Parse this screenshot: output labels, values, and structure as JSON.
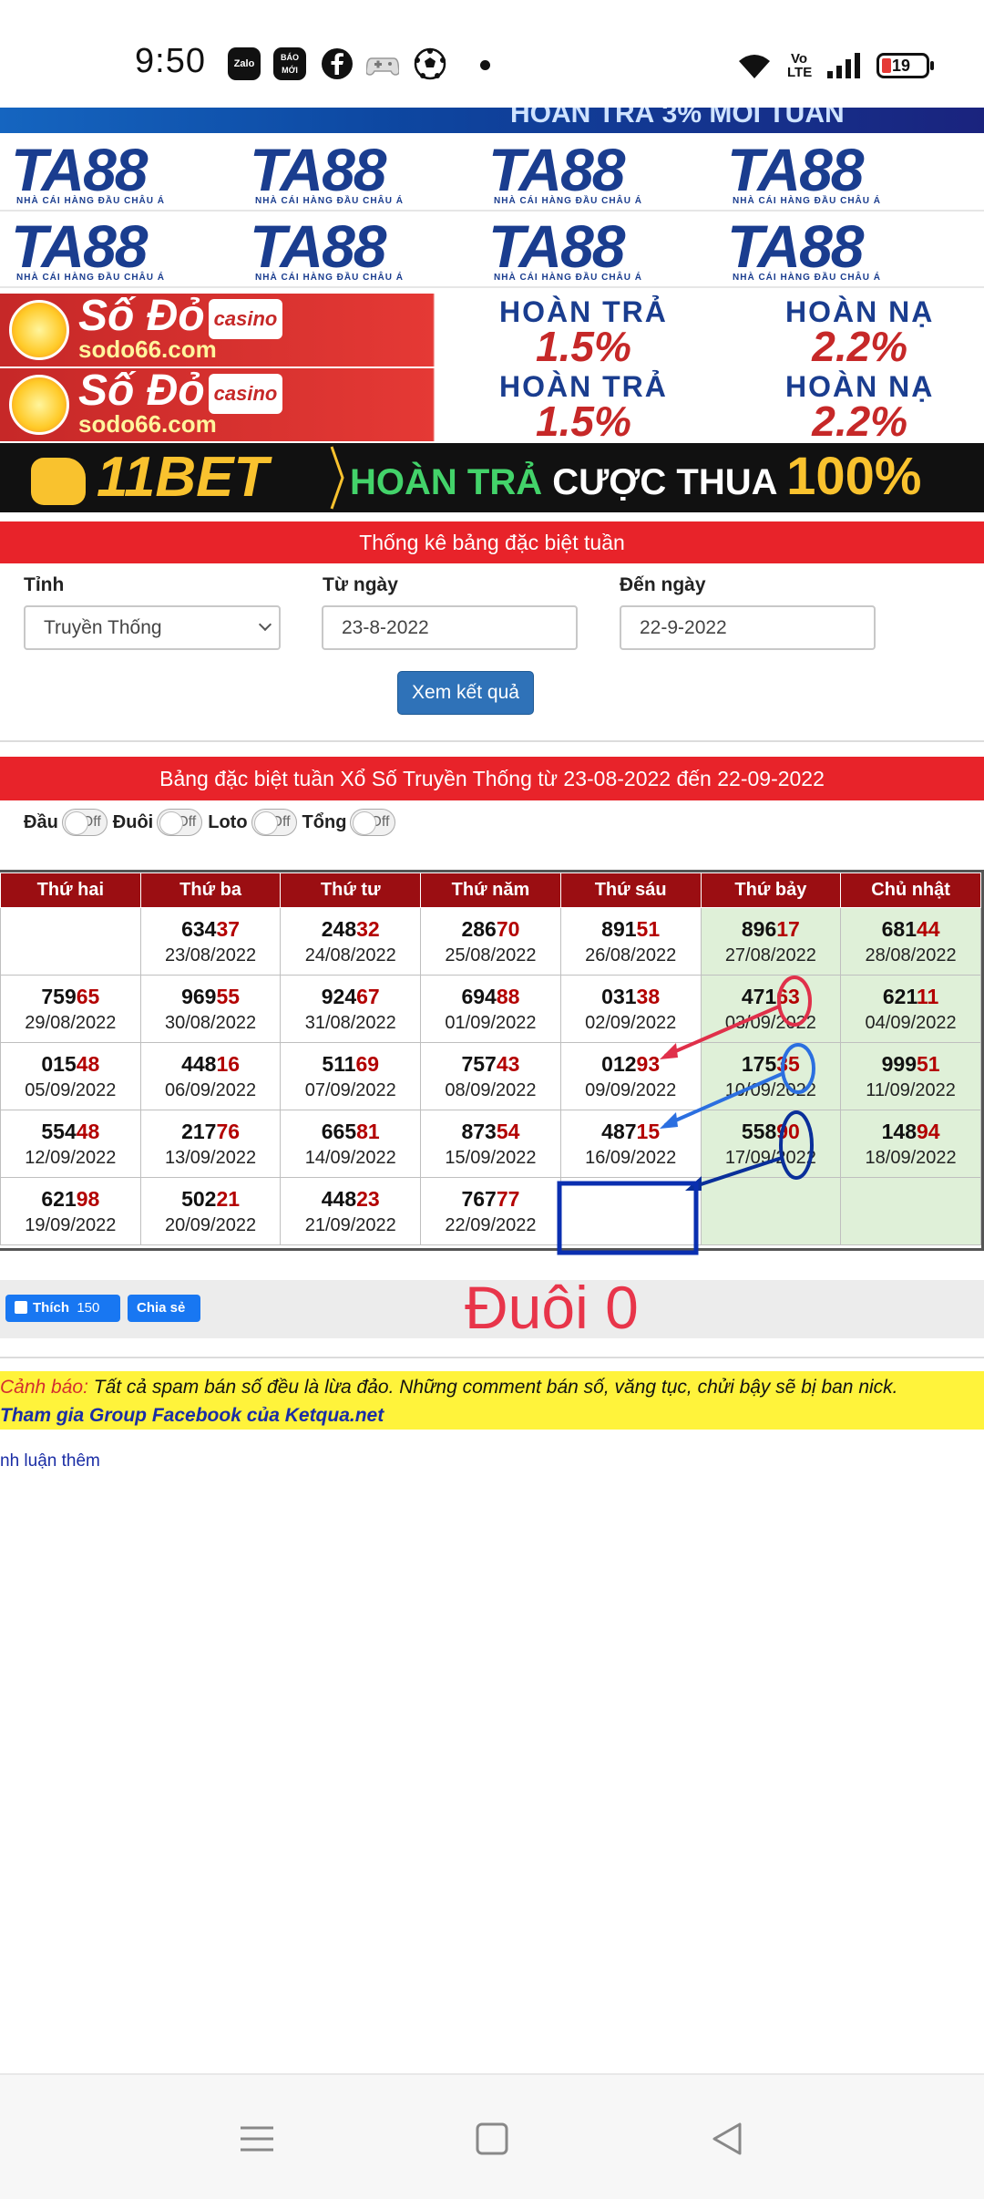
{
  "status_bar": {
    "time": "9:50",
    "apps": [
      "Zalo",
      "BÁO MỚI"
    ],
    "volte": "Vo LTE",
    "battery": "19"
  },
  "banners": {
    "top_text": "HOÀN TRẢ 3% MỖI TUẦN",
    "ta88_logo": "TA88",
    "ta88_tagline": "NHÀ CÁI HÀNG ĐẦU CHÂU Á",
    "sodo_brand": "Số Đỏ",
    "sodo_casino": "casino",
    "sodo_site": "sodo66.com",
    "sodo_label1": "HOÀN TRẢ",
    "sodo_value1": "1.5%",
    "sodo_label2": "HOÀN NẠ",
    "sodo_value2": "2.2%",
    "bet_logo": "11BET",
    "bet_text1": "HOÀN TRẢ",
    "bet_text2": "CƯỢC THUA",
    "bet_value": "100%"
  },
  "filter": {
    "title": "Thống kê bảng đặc biệt tuần",
    "province_label": "Tỉnh",
    "province_value": "Truyền Thống",
    "from_label": "Từ ngày",
    "from_value": "23-8-2022",
    "to_label": "Đến ngày",
    "to_value": "22-9-2022",
    "submit_label": "Xem kết quả"
  },
  "result": {
    "title": "Bảng đặc biệt tuần Xổ Số Truyền Thống từ 23-08-2022 đến 22-09-2022",
    "toggles": [
      {
        "label": "Đầu",
        "state": "Off"
      },
      {
        "label": "Đuôi",
        "state": "Off"
      },
      {
        "label": "Loto",
        "state": "Off"
      },
      {
        "label": "Tổng",
        "state": "Off"
      }
    ],
    "headers": [
      "Thứ hai",
      "Thứ ba",
      "Thứ tư",
      "Thứ năm",
      "Thứ sáu",
      "Thứ bảy",
      "Chủ nhật"
    ],
    "rows": [
      [
        null,
        {
          "head": "634",
          "tail": "37",
          "date": "23/08/2022"
        },
        {
          "head": "248",
          "tail": "32",
          "date": "24/08/2022"
        },
        {
          "head": "286",
          "tail": "70",
          "date": "25/08/2022"
        },
        {
          "head": "891",
          "tail": "51",
          "date": "26/08/2022"
        },
        {
          "head": "896",
          "tail": "17",
          "date": "27/08/2022"
        },
        {
          "head": "681",
          "tail": "44",
          "date": "28/08/2022"
        }
      ],
      [
        {
          "head": "759",
          "tail": "65",
          "date": "29/08/2022"
        },
        {
          "head": "969",
          "tail": "55",
          "date": "30/08/2022"
        },
        {
          "head": "924",
          "tail": "67",
          "date": "31/08/2022"
        },
        {
          "head": "694",
          "tail": "88",
          "date": "01/09/2022"
        },
        {
          "head": "031",
          "tail": "38",
          "date": "02/09/2022"
        },
        {
          "head": "471",
          "tail": "63",
          "date": "03/09/2022"
        },
        {
          "head": "621",
          "tail": "11",
          "date": "04/09/2022"
        }
      ],
      [
        {
          "head": "015",
          "tail": "48",
          "date": "05/09/2022"
        },
        {
          "head": "448",
          "tail": "16",
          "date": "06/09/2022"
        },
        {
          "head": "511",
          "tail": "69",
          "date": "07/09/2022"
        },
        {
          "head": "757",
          "tail": "43",
          "date": "08/09/2022"
        },
        {
          "head": "012",
          "tail": "93",
          "date": "09/09/2022"
        },
        {
          "head": "175",
          "tail": "35",
          "date": "10/09/2022"
        },
        {
          "head": "999",
          "tail": "51",
          "date": "11/09/2022"
        }
      ],
      [
        {
          "head": "554",
          "tail": "48",
          "date": "12/09/2022"
        },
        {
          "head": "217",
          "tail": "76",
          "date": "13/09/2022"
        },
        {
          "head": "665",
          "tail": "81",
          "date": "14/09/2022"
        },
        {
          "head": "873",
          "tail": "54",
          "date": "15/09/2022"
        },
        {
          "head": "487",
          "tail": "15",
          "date": "16/09/2022"
        },
        {
          "head": "558",
          "tail": "90",
          "date": "17/09/2022"
        },
        {
          "head": "148",
          "tail": "94",
          "date": "18/09/2022"
        }
      ],
      [
        {
          "head": "621",
          "tail": "98",
          "date": "19/09/2022"
        },
        {
          "head": "502",
          "tail": "21",
          "date": "20/09/2022"
        },
        {
          "head": "448",
          "tail": "23",
          "date": "21/09/2022"
        },
        {
          "head": "767",
          "tail": "77",
          "date": "22/09/2022"
        },
        null,
        null,
        null
      ]
    ]
  },
  "share": {
    "like_label": "Thích",
    "like_count": "150",
    "share_label": "Chia sẻ"
  },
  "annotation": "Đuôi 0",
  "warning": {
    "prefix": "Cảnh báo:",
    "text": " Tất cả spam bán số đều là lừa đảo. Những comment bán số, văng tục, chửi bậy sẽ bị ban nick.",
    "link": "Tham gia Group Facebook của Ketqua.net"
  },
  "comments_more": "nh luận thêm",
  "colors": {
    "red_bar": "#e8232a",
    "table_header": "#9b0e12",
    "weekend": "#dff0d8",
    "tail_digits": "#b30000",
    "button": "#2f72b8",
    "annotation": "#e8354a",
    "warning_bg": "#fff33b"
  }
}
